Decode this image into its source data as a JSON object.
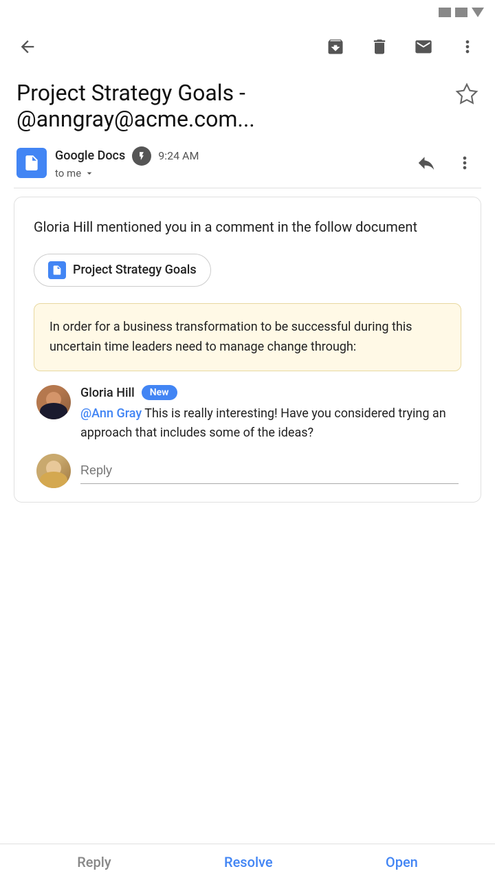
{
  "statusBar": {
    "icons": [
      "signal-icon",
      "wifi-icon",
      "dropdown-icon"
    ]
  },
  "toolbar": {
    "back_label": "←",
    "archive_label": "archive",
    "delete_label": "delete",
    "email_label": "email",
    "more_label": "more"
  },
  "email": {
    "title": "Project Strategy Goals - @anngray@acme.com...",
    "sender": "Google Docs",
    "time": "9:24 AM",
    "recipient": "to me",
    "mention_text": "Gloria Hill mentioned you in a comment in the follow document",
    "doc_title": "Project Strategy Goals",
    "quoted_text": "In order for a business transformation to be successful during this uncertain time leaders need to manage change through:",
    "comment": {
      "author": "Gloria Hill",
      "badge": "New",
      "mention": "@Ann Gray",
      "body": " This is really interesting! Have you considered trying an approach that includes some of the ideas?"
    }
  },
  "reply": {
    "placeholder": "Reply"
  },
  "bottomBar": {
    "reply": "Reply",
    "resolve": "Resolve",
    "open": "Open"
  }
}
